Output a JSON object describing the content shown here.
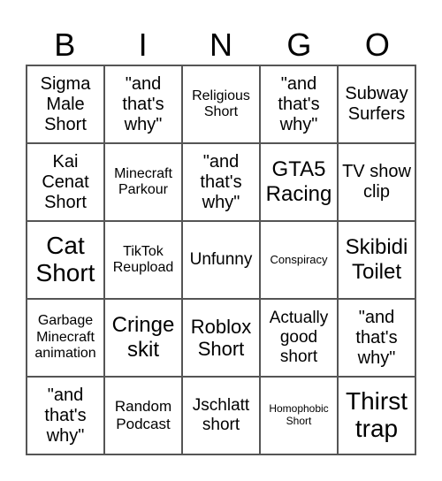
{
  "header": [
    "B",
    "I",
    "N",
    "G",
    "O"
  ],
  "cells": [
    "Sigma Male Short",
    "\"and that's why\"",
    "Religious Short",
    "\"and that's why\"",
    "Subway Surfers",
    "Kai Cenat Short",
    "Minecraft Parkour",
    "\"and that's why\"",
    "GTA5 Racing",
    "TV show clip",
    "Cat Short",
    "TikTok Reupload",
    "Unfunny",
    "Conspiracy",
    "Skibidi Toilet",
    "Garbage Minecraft animation",
    "Cringe skit",
    "Roblox Short",
    "Actually good short",
    "\"and that's why\"",
    "\"and that's why\"",
    "Random Podcast",
    "Jschlatt short",
    "Homophobic Short",
    "Thirst trap"
  ]
}
